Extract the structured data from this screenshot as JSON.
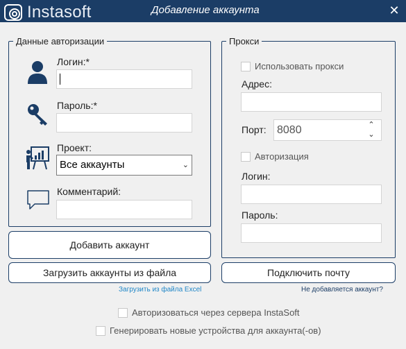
{
  "window": {
    "logo_text": "Instasoft",
    "title": "Добавление аккаунта",
    "close_glyph": "✕"
  },
  "auth": {
    "legend": "Данные авторизации",
    "login_label": "Логин:*",
    "login_value": "",
    "password_label": "Пароль:*",
    "password_value": "",
    "project_label": "Проект:",
    "project_selected": "Все аккаунты",
    "comment_label": "Комментарий:",
    "comment_value": "",
    "icons": [
      "user-icon",
      "key-icon",
      "presentation-icon",
      "comment-icon"
    ]
  },
  "proxy": {
    "legend": "Прокси",
    "use_proxy_label": "Использовать прокси",
    "use_proxy_checked": false,
    "address_label": "Адрес:",
    "address_value": "",
    "port_label": "Порт:",
    "port_value": "8080",
    "auth_label": "Авторизация",
    "auth_checked": false,
    "login_label": "Логин:",
    "login_value": "",
    "password_label": "Пароль:",
    "password_value": ""
  },
  "buttons": {
    "add_account": "Добавить аккаунт",
    "load_from_file": "Загрузить аккаунты из файла",
    "connect_mail": "Подключить почту"
  },
  "links": {
    "load_excel": "Загрузить из файла Excel",
    "not_added": "Не добавляется аккаунт?"
  },
  "options": {
    "server_auth_label": "Авторизоваться через сервера InstaSoft",
    "server_auth_checked": false,
    "new_devices_label": "Генерировать новые устройства для аккаунта(-ов)",
    "new_devices_checked": false
  },
  "colors": {
    "titlebar": "#1b3d66",
    "background": "#f0f0f0",
    "link": "#1f86c7"
  }
}
